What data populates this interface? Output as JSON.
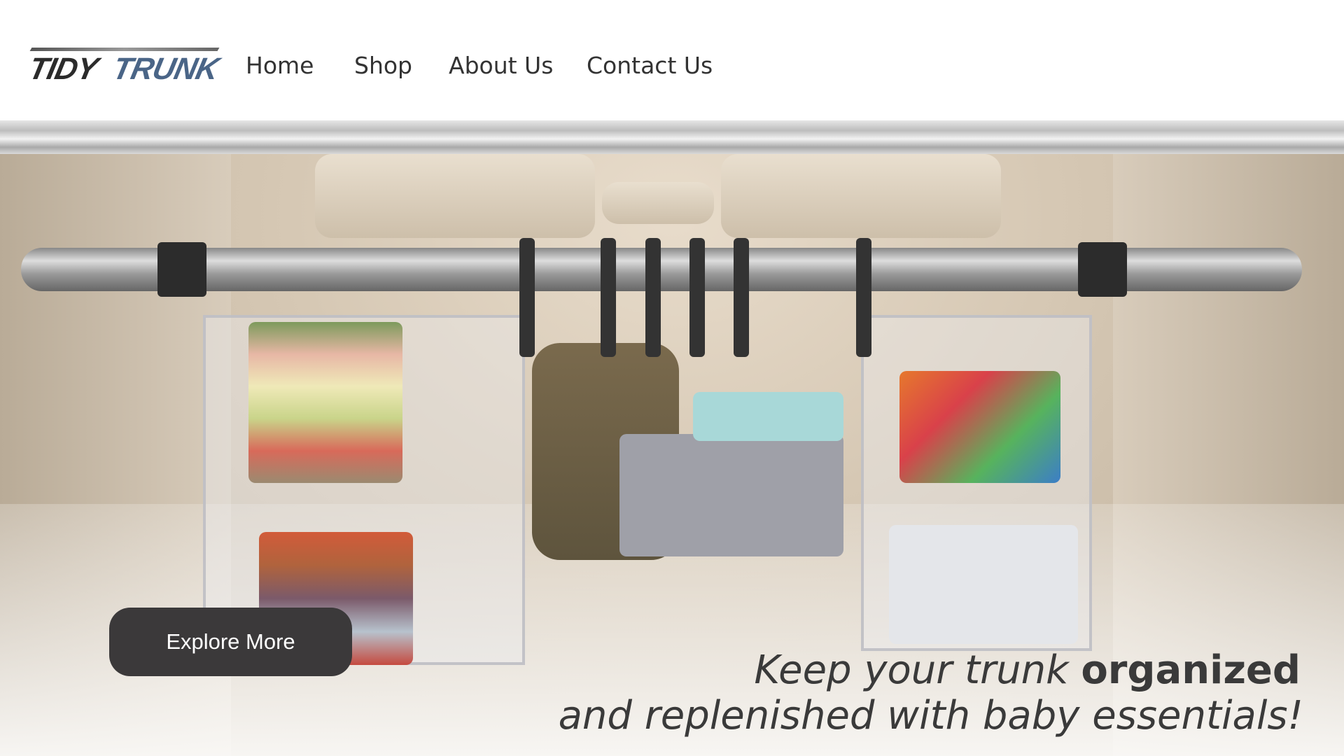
{
  "brand": {
    "logo_part1": "TIDY",
    "logo_part2": "TRUNK"
  },
  "nav": {
    "items": [
      {
        "label": "Home"
      },
      {
        "label": "Shop"
      },
      {
        "label": "About Us"
      },
      {
        "label": "Contact Us"
      }
    ]
  },
  "hero": {
    "cta_label": "Explore More",
    "tagline_line1_pre": "Keep your trunk ",
    "tagline_line1_bold": "organized",
    "tagline_line2": "and replenished with baby essentials!"
  },
  "colors": {
    "button": "#3b393a",
    "logo_dark": "#2b2b2b",
    "logo_blue": "#4a6587"
  }
}
